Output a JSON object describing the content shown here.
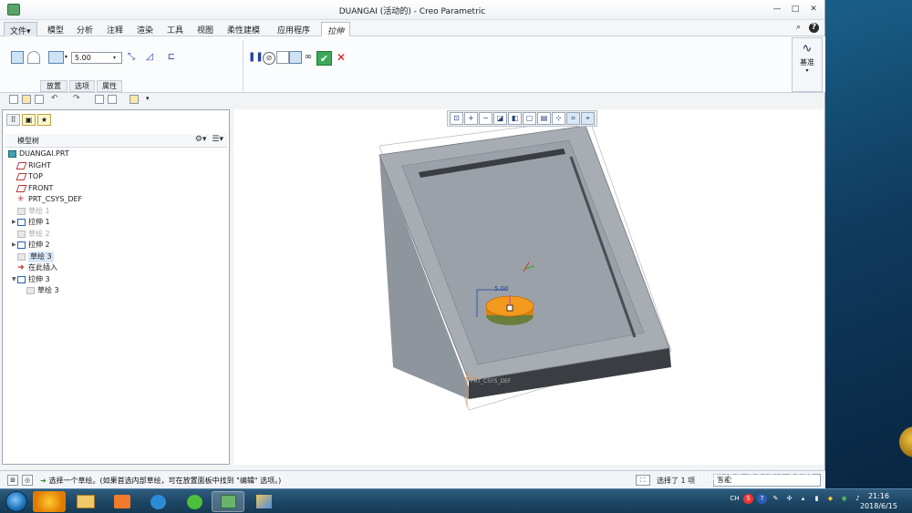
{
  "window": {
    "title": "DUANGAI (活动的) - Creo Parametric",
    "controls": [
      "—",
      "□",
      "✕"
    ]
  },
  "menu": {
    "file": "文件▾",
    "tabs": [
      "模型",
      "分析",
      "注释",
      "渲染",
      "工具",
      "视图",
      "柔性建模",
      "应用程序"
    ],
    "active_tab": "拉伸"
  },
  "ribbon": {
    "depth_value": "5.00",
    "sub_tabs": [
      "放置",
      "选项",
      "属性"
    ],
    "datum_label": "基准"
  },
  "model_tree": {
    "title": "模型树",
    "items": [
      {
        "label": "DUANGAI.PRT",
        "icon": "part-icon",
        "indent": 0,
        "state": "normal"
      },
      {
        "label": "RIGHT",
        "icon": "datum-plane-icon",
        "indent": 1,
        "state": "normal"
      },
      {
        "label": "TOP",
        "icon": "datum-plane-icon",
        "indent": 1,
        "state": "normal"
      },
      {
        "label": "FRONT",
        "icon": "datum-plane-icon",
        "indent": 1,
        "state": "normal"
      },
      {
        "label": "PRT_CSYS_DEF",
        "icon": "csys-icon",
        "indent": 1,
        "state": "normal"
      },
      {
        "label": "草绘 1",
        "icon": "sketch-icon",
        "indent": 1,
        "state": "dim"
      },
      {
        "label": "拉伸 1",
        "icon": "extrude-icon",
        "indent": 1,
        "state": "normal",
        "expandable": true
      },
      {
        "label": "草绘 2",
        "icon": "sketch-icon",
        "indent": 1,
        "state": "dim"
      },
      {
        "label": "拉伸 2",
        "icon": "extrude-icon",
        "indent": 1,
        "state": "normal",
        "expandable": true
      },
      {
        "label": "草绘 3",
        "icon": "sketch-icon",
        "indent": 1,
        "state": "highlight"
      },
      {
        "label": "在此插入",
        "icon": "insert-here-icon",
        "indent": 1,
        "state": "normal"
      },
      {
        "label": "拉伸 3",
        "icon": "extrude-icon",
        "indent": 1,
        "state": "normal",
        "expanded": true
      },
      {
        "label": "草绘 3",
        "icon": "sketch-icon",
        "indent": 2,
        "state": "normal"
      }
    ]
  },
  "viewport": {
    "dimension_label": "5.00",
    "csys_label": "PRT_CSYS_DEF"
  },
  "status": {
    "message": "选择一个草绘。(如果首选内部草绘，可在放置面板中找到 \"编辑\" 选项。)",
    "selection_count": "选择了 1 项",
    "filter_value": "智能"
  },
  "taskbar": {
    "lang": "CH",
    "time": "21:16",
    "date": "2018/6/15"
  },
  "watermark": {
    "brand": "Baidu经验",
    "url": "jingyan.baidu.com"
  },
  "colors": {
    "model_body": "#8c939b",
    "model_top": "#a7adb3",
    "model_side_dark": "#3a3d42",
    "boss": "#f39a1e",
    "accent_blue": "#1e3fa8",
    "ok_green": "#3da85a"
  }
}
